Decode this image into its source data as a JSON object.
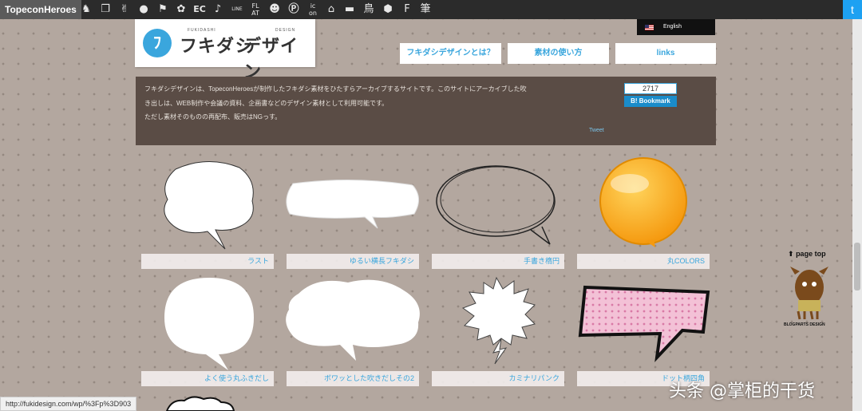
{
  "topbar": {
    "brand": "TopeconHeroes",
    "icons": [
      "horse-icon",
      "copy-icon",
      "person-icon",
      "speech-icon",
      "flag-icon",
      "flower-icon",
      "ec-text-icon",
      "note-icon",
      "line-text-icon",
      "flat-text-icon",
      "smile-icon",
      "parking-icon",
      "icon-text-icon",
      "house-icon",
      "bed-icon",
      "bird-icon",
      "hexagon-icon",
      "fuki-icon",
      "kanji-icon"
    ],
    "icon_texts": [
      "EC",
      "LINE",
      "FL AT",
      "ic on"
    ],
    "twitter_icon": "twitter-icon"
  },
  "logo": {
    "mark": "ﾌ",
    "kana_left": "フキダシ",
    "kana_right": "デザイン",
    "sub_left": "FUKIDASHI",
    "sub_right": "DESIGN"
  },
  "language": {
    "label": "English"
  },
  "nav": [
    "フキダシデザインとは？",
    "素材の使い方",
    "links"
  ],
  "info": {
    "line1": "フキダシデザインは、TopeconHeroesが制作したフキダシ素材をひたすらアーカイブするサイトです。このサイトにアーカイブした吹",
    "line2": "き出しは、WEB制作や会議の資料、企画書などのデザイン素材として利用可能です。",
    "line3": "ただし素材そのものの再配布、販売はNGっす。",
    "tweet": "Tweet",
    "bookmark_count": "2717",
    "bookmark_label": "B! Bookmark"
  },
  "cards": [
    {
      "label": "ラスト"
    },
    {
      "label": "ゆるい横長フキダシ"
    },
    {
      "label": "手書き楕円"
    },
    {
      "label": "丸COLORS"
    },
    {
      "label": "よく使う丸ふきだし"
    },
    {
      "label": "ボワッとした吹きだしその2"
    },
    {
      "label": "カミナリパンク"
    },
    {
      "label": "ドット柄四角"
    }
  ],
  "page_top": "page top",
  "blogparts": "BLOGPARTS DESIGN",
  "status_url": "http://fukidesign.com/wp/%3Fp%3D903",
  "watermark": "头条 @掌柜的干货",
  "colors": {
    "accent": "#3aa6dd",
    "info_bg": "#5a4c45",
    "topbar": "#2b2b2b",
    "orange": "#f8a81c"
  }
}
